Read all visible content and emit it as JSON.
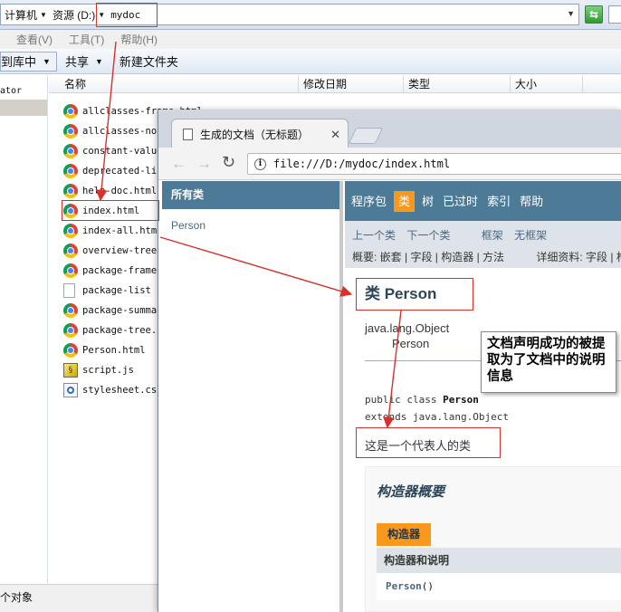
{
  "explorer": {
    "breadcrumbs": [
      "计算机",
      "资源 (D:)",
      "mydoc"
    ],
    "menu": [
      "查看(V)",
      "工具(T)",
      "帮助(H)"
    ],
    "toolbar": {
      "library": "到库中",
      "share": "共享",
      "new_folder": "新建文件夹"
    },
    "nav_fragment": "ator",
    "columns": [
      "名称",
      "修改日期",
      "类型",
      "大小"
    ],
    "files": [
      {
        "name": "allclasses-frame.html",
        "icon": "chrome-icon"
      },
      {
        "name": "allclasses-noframe.html",
        "icon": "chrome-icon"
      },
      {
        "name": "constant-values.html",
        "icon": "chrome-icon"
      },
      {
        "name": "deprecated-list.html",
        "icon": "chrome-icon"
      },
      {
        "name": "help-doc.html",
        "icon": "chrome-icon"
      },
      {
        "name": "index.html",
        "icon": "chrome-icon"
      },
      {
        "name": "index-all.html",
        "icon": "chrome-icon"
      },
      {
        "name": "overview-tree.html",
        "icon": "chrome-icon"
      },
      {
        "name": "package-frame.html",
        "icon": "chrome-icon"
      },
      {
        "name": "package-list",
        "icon": "document-icon"
      },
      {
        "name": "package-summary.html",
        "icon": "chrome-icon"
      },
      {
        "name": "package-tree.html",
        "icon": "chrome-icon"
      },
      {
        "name": "Person.html",
        "icon": "chrome-icon"
      },
      {
        "name": "script.js",
        "icon": "script-icon"
      },
      {
        "name": "stylesheet.css",
        "icon": "stylesheet-icon"
      }
    ],
    "status": "个对象"
  },
  "browser": {
    "tab_title": "生成的文档（无标题）",
    "url": "file:///D:/mydoc/index.html",
    "left_frame": {
      "header": "所有类",
      "items": [
        "Person"
      ]
    },
    "top_nav": [
      "程序包",
      "类",
      "树",
      "已过时",
      "索引",
      "帮助"
    ],
    "top_nav_active": "类",
    "sub_nav": {
      "prev": "上一个类",
      "next": "下一个类",
      "frames": "框架",
      "no_frames": "无框架",
      "summary": "概要: 嵌套 | 字段 | 构造器 | 方法",
      "detail": "详细资料: 字段 | 构"
    },
    "class_title": "类 Person",
    "inheritance": [
      "java.lang.Object",
      "Person"
    ],
    "declaration": {
      "kw": "public class",
      "name": "Person",
      "extends": "extends java.lang.Object"
    },
    "description": "这是一个代表人的类",
    "summary": {
      "title": "构造器概要",
      "tab": "构造器",
      "header": "构造器和说明",
      "ctor_name": "Person",
      "ctor_args": "()"
    }
  },
  "annotation": {
    "callout": "文档声明成功的被提取为了文档中的说明信息",
    "color": "#d9302a"
  }
}
